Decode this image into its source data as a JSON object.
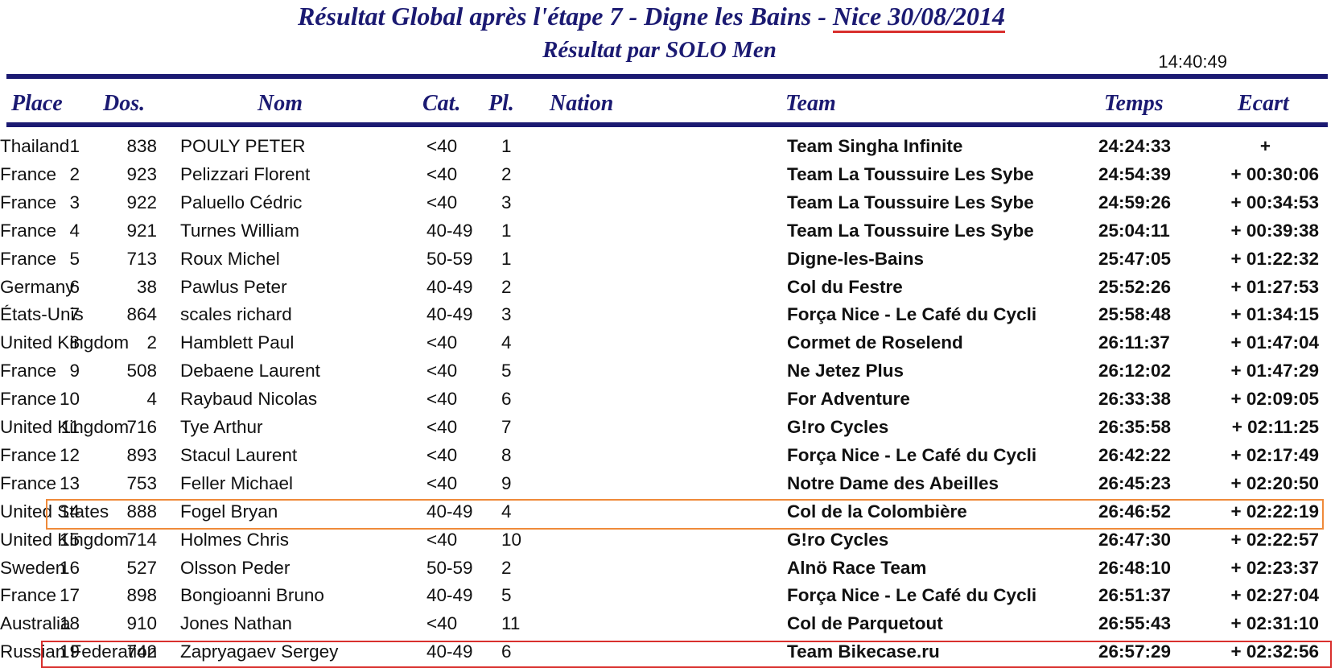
{
  "header": {
    "title_part1": "Résultat Global après l'étape 7 -  Digne les Bains - ",
    "title_part2": "Nice 30/08/2014 ",
    "subtitle": "Résultat par SOLO Men",
    "time": "14:40:49"
  },
  "columns": {
    "place": "Place",
    "dos": "Dos.",
    "nom": "Nom",
    "cat": "Cat.",
    "pl": "Pl.",
    "nation": "Nation",
    "team": "Team",
    "temps": "Temps",
    "ecart": "Ecart"
  },
  "rows": [
    {
      "place": "1",
      "dos": "838",
      "nom": "POULY PETER",
      "cat": "<40",
      "pl": "1",
      "nation": "Thailand",
      "team": "Team Singha Infinite",
      "temps": "24:24:33",
      "ecart": "+"
    },
    {
      "place": "2",
      "dos": "923",
      "nom": "Pelizzari Florent",
      "cat": "<40",
      "pl": "2",
      "nation": "France",
      "team": "Team La Toussuire Les Sybe",
      "temps": "24:54:39",
      "ecart": "+ 00:30:06"
    },
    {
      "place": "3",
      "dos": "922",
      "nom": "Paluello Cédric",
      "cat": "<40",
      "pl": "3",
      "nation": "France",
      "team": "Team La Toussuire Les Sybe",
      "temps": "24:59:26",
      "ecart": "+ 00:34:53"
    },
    {
      "place": "4",
      "dos": "921",
      "nom": "Turnes William",
      "cat": "40-49",
      "pl": "1",
      "nation": "France",
      "team": "Team La Toussuire Les Sybe",
      "temps": "25:04:11",
      "ecart": "+ 00:39:38"
    },
    {
      "place": "5",
      "dos": "713",
      "nom": "Roux Michel",
      "cat": "50-59",
      "pl": "1",
      "nation": "France",
      "team": "Digne-les-Bains",
      "temps": "25:47:05",
      "ecart": "+ 01:22:32"
    },
    {
      "place": "6",
      "dos": "38",
      "nom": "Pawlus Peter",
      "cat": "40-49",
      "pl": "2",
      "nation": "Germany",
      "team": "Col du Festre",
      "temps": "25:52:26",
      "ecart": "+ 01:27:53"
    },
    {
      "place": "7",
      "dos": "864",
      "nom": "scales richard",
      "cat": "40-49",
      "pl": "3",
      "nation": "États-Unis",
      "team": "Força Nice - Le Café du Cycli",
      "temps": "25:58:48",
      "ecart": "+ 01:34:15"
    },
    {
      "place": "8",
      "dos": "2",
      "nom": "Hamblett Paul",
      "cat": "<40",
      "pl": "4",
      "nation": "United Kingdom",
      "team": "Cormet de Roselend",
      "temps": "26:11:37",
      "ecart": "+ 01:47:04"
    },
    {
      "place": "9",
      "dos": "508",
      "nom": "Debaene Laurent",
      "cat": "<40",
      "pl": "5",
      "nation": "France",
      "team": "Ne Jetez Plus",
      "temps": "26:12:02",
      "ecart": "+ 01:47:29"
    },
    {
      "place": "10",
      "dos": "4",
      "nom": "Raybaud Nicolas",
      "cat": "<40",
      "pl": "6",
      "nation": "France",
      "team": "For Adventure",
      "temps": "26:33:38",
      "ecart": "+ 02:09:05"
    },
    {
      "place": "11",
      "dos": "716",
      "nom": "Tye Arthur",
      "cat": "<40",
      "pl": "7",
      "nation": "United Kingdom",
      "team": "G!ro Cycles",
      "temps": "26:35:58",
      "ecart": "+ 02:11:25"
    },
    {
      "place": "12",
      "dos": "893",
      "nom": "Stacul Laurent",
      "cat": "<40",
      "pl": "8",
      "nation": "France",
      "team": "Força Nice - Le Café du Cycli",
      "temps": "26:42:22",
      "ecart": "+ 02:17:49"
    },
    {
      "place": "13",
      "dos": "753",
      "nom": "Feller Michael",
      "cat": "<40",
      "pl": "9",
      "nation": "France",
      "team": "Notre Dame des Abeilles",
      "temps": "26:45:23",
      "ecart": "+ 02:20:50"
    },
    {
      "place": "14",
      "dos": "888",
      "nom": "Fogel Bryan",
      "cat": "40-49",
      "pl": "4",
      "nation": "United States",
      "team": "Col de la Colombière",
      "temps": "26:46:52",
      "ecart": "+ 02:22:19"
    },
    {
      "place": "15",
      "dos": "714",
      "nom": "Holmes Chris",
      "cat": "<40",
      "pl": "10",
      "nation": "United Kingdom",
      "team": "G!ro Cycles",
      "temps": "26:47:30",
      "ecart": "+ 02:22:57"
    },
    {
      "place": "16",
      "dos": "527",
      "nom": "Olsson Peder",
      "cat": "50-59",
      "pl": "2",
      "nation": "Sweden",
      "team": "Alnö Race Team",
      "temps": "26:48:10",
      "ecart": "+ 02:23:37"
    },
    {
      "place": "17",
      "dos": "898",
      "nom": "Bongioanni Bruno",
      "cat": "40-49",
      "pl": "5",
      "nation": "France",
      "team": "Força Nice - Le Café du Cycli",
      "temps": "26:51:37",
      "ecart": "+ 02:27:04"
    },
    {
      "place": "18",
      "dos": "910",
      "nom": "Jones Nathan",
      "cat": "<40",
      "pl": "11",
      "nation": "Australia",
      "team": "Col de Parquetout",
      "temps": "26:55:43",
      "ecart": "+ 02:31:10"
    },
    {
      "place": "19",
      "dos": "742",
      "nom": "Zapryagaev Sergey",
      "cat": "40-49",
      "pl": "6",
      "nation": "Russian Federation",
      "team": "Team Bikecase.ru",
      "temps": "26:57:29",
      "ecart": "+ 02:32:56"
    }
  ],
  "highlights": {
    "orange_row": "14",
    "red_row": "19",
    "orange_color": "#ef8a3a",
    "red_color": "#d9302e",
    "header_color": "#1b1a72"
  }
}
